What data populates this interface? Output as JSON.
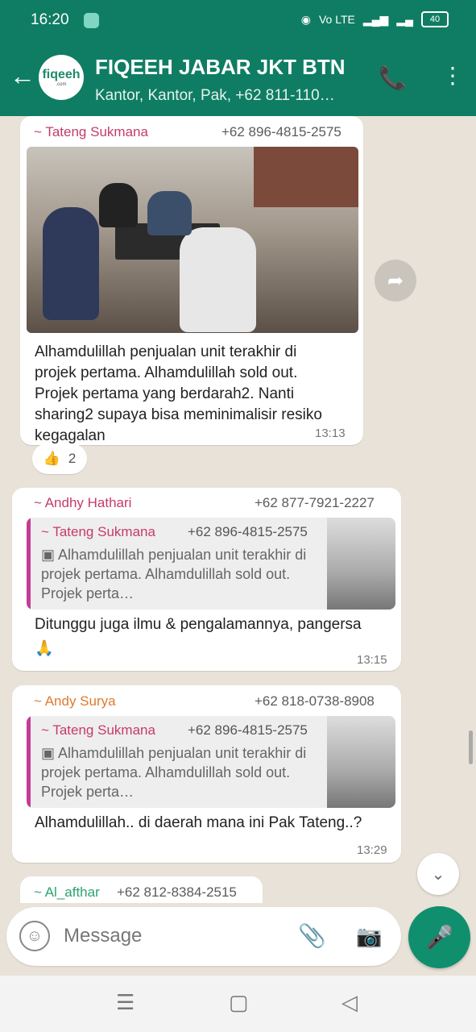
{
  "status_bar": {
    "time": "16:20",
    "battery": "40",
    "network": "Vo LTE"
  },
  "header": {
    "avatar_label": "fiqeeh",
    "avatar_sublabel": ".com",
    "title": "FIQEEH JABAR JKT BTN",
    "subtitle": "Kantor, Kantor, Pak, +62 811-110…",
    "icons": [
      "back-arrow-icon",
      "add-call-icon",
      "more-vertical-icon"
    ]
  },
  "messages": [
    {
      "sender": "~ Tateng Sukmana",
      "phone": "+62 896-4815-2575",
      "text": "Alhamdulillah penjualan unit terakhir di projek pertama. Alhamdulillah sold out. Projek pertama yang berdarah2. Nanti sharing2 supaya bisa meminimalisir resiko kegagalan",
      "time": "13:13",
      "reaction_emoji": "👍",
      "reaction_count": "2"
    },
    {
      "sender": "~ Andhy Hathari",
      "phone": "+62 877-7921-2227",
      "quote_sender": "~ Tateng Sukmana",
      "quote_phone": "+62 896-4815-2575",
      "quote_text": "Alhamdulillah penjualan unit terakhir di projek pertama. Alhamdulillah sold out. Projek perta…",
      "text": "Ditunggu juga ilmu & pengalamannya,  pangersa",
      "emoji": "🙏",
      "time": "13:15"
    },
    {
      "sender": "~ Andy Surya",
      "phone": "+62 818-0738-8908",
      "quote_sender": "~ Tateng Sukmana",
      "quote_phone": "+62 896-4815-2575",
      "quote_text": "Alhamdulillah penjualan unit terakhir di projek pertama. Alhamdulillah sold out. Projek perta…",
      "text": "Alhamdulillah.. di daerah mana ini Pak Tateng..?",
      "time": "13:29"
    },
    {
      "sender": "~ Al_afthar",
      "phone": "+62 812-8384-2515"
    }
  ],
  "composer": {
    "placeholder": "Message",
    "icons": [
      "emoji-icon",
      "attach-icon",
      "camera-icon",
      "mic-icon"
    ]
  },
  "nav_icons": [
    "recents-icon",
    "home-icon",
    "back-icon"
  ]
}
